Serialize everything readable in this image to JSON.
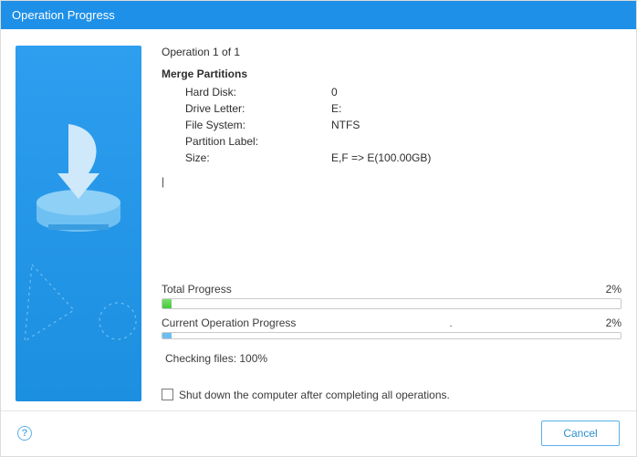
{
  "titlebar": {
    "title": "Operation Progress"
  },
  "operation": {
    "header": "Operation 1 of 1",
    "title": "Merge Partitions",
    "rows": [
      {
        "key": "Hard Disk:",
        "val": "0"
      },
      {
        "key": "Drive Letter:",
        "val": "E:"
      },
      {
        "key": "File System:",
        "val": "NTFS"
      },
      {
        "key": "Partition Label:",
        "val": ""
      },
      {
        "key": "Size:",
        "val": "E,F => E(100.00GB)"
      }
    ]
  },
  "progress": {
    "total_label": "Total Progress",
    "total_pct": "2%",
    "current_label": "Current Operation Progress",
    "current_mid": ".",
    "current_pct": "2%",
    "status": "Checking files: 100%"
  },
  "shutdown": {
    "label": "Shut down the computer after completing all operations."
  },
  "footer": {
    "cancel": "Cancel"
  },
  "chart_data": {
    "type": "bar",
    "series": [
      {
        "name": "Total Progress",
        "values": [
          2
        ]
      },
      {
        "name": "Current Operation Progress",
        "values": [
          2
        ]
      }
    ],
    "categories": [
      ""
    ],
    "ylim": [
      0,
      100
    ],
    "title": "",
    "xlabel": "",
    "ylabel": "%"
  }
}
